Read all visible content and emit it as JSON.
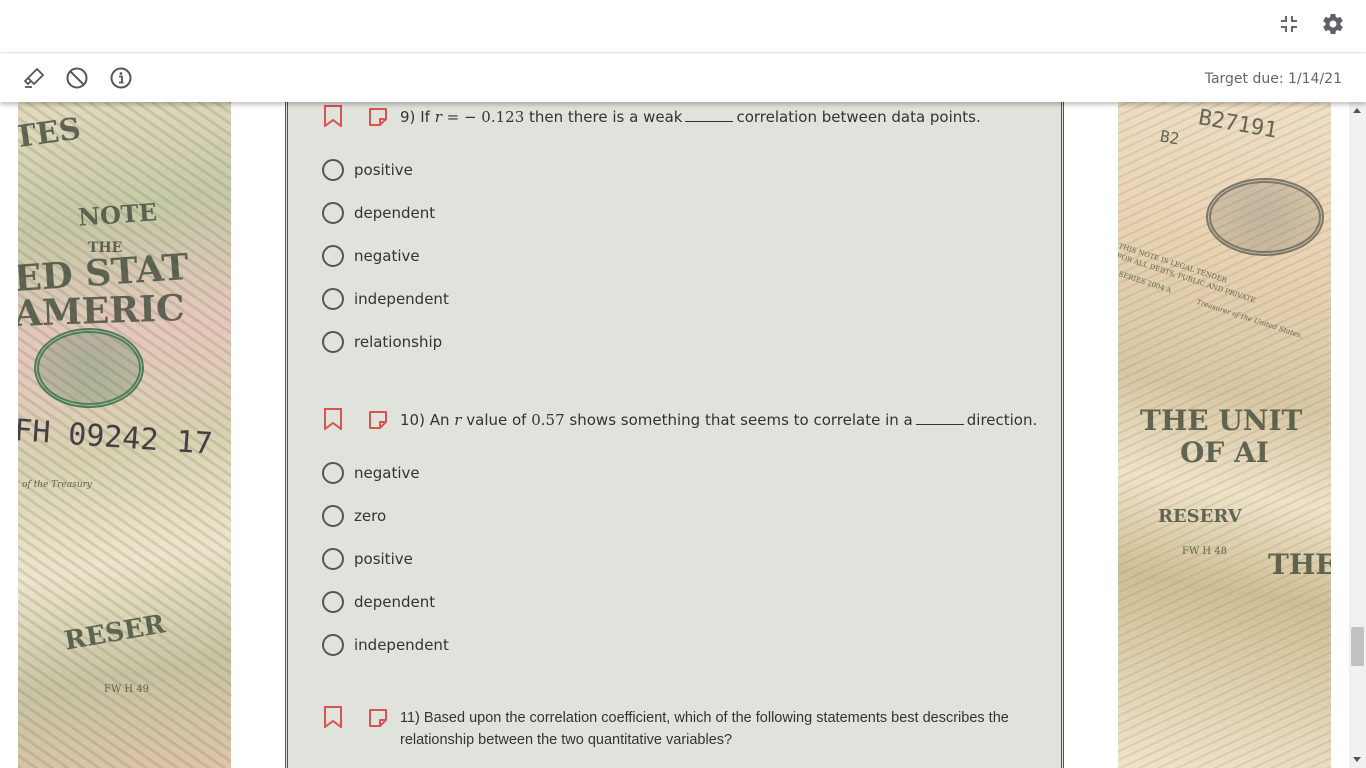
{
  "header": {
    "icons": [
      "collapse-icon",
      "gear-icon"
    ]
  },
  "toolbar": {
    "icons": [
      "highlighter-icon",
      "eliminate-icon",
      "info-icon"
    ],
    "target_due": "Target due: 1/14/21"
  },
  "background_bills": {
    "left_texts": [
      "TES",
      "NOTE",
      "THE",
      "ED STAT",
      "AMERIC",
      "FH 09242 17",
      "of the Treasury",
      "RESER",
      "FW H 49"
    ],
    "right_texts": [
      "B27191",
      "B2",
      "THIS NOTE IS LEGAL TENDER",
      "FOR ALL DEBTS, PUBLIC AND PRIVATE",
      "SERIES 2004 A",
      "Treasurer of the United States.",
      "THE UNIT",
      "OF AI",
      "RESERV",
      "FW H 48",
      "THE"
    ]
  },
  "questions": [
    {
      "number": "9)",
      "text_before": "If",
      "math_var": "r",
      "math_eq": " = ",
      "math_val": " − 0.123",
      "text_mid": "then there is a weak",
      "text_after": "correlation between data points.",
      "options": [
        "positive",
        "dependent",
        "negative",
        "independent",
        "relationship"
      ]
    },
    {
      "number": "10)",
      "text_before": "An",
      "math_var": "r",
      "text_mid": "value of",
      "math_val": "0.57",
      "text_mid2": "shows something that seems to correlate in a",
      "text_after": "direction.",
      "options": [
        "negative",
        "zero",
        "positive",
        "dependent",
        "independent"
      ]
    },
    {
      "number": "11)",
      "text": "Based upon the correlation coefficient, which of the following statements best describes the relationship between the two quantitative variables?"
    }
  ],
  "colors": {
    "bookmark": "#d9534f",
    "panel_bg": "#e0e3dc",
    "icon": "#555555"
  }
}
